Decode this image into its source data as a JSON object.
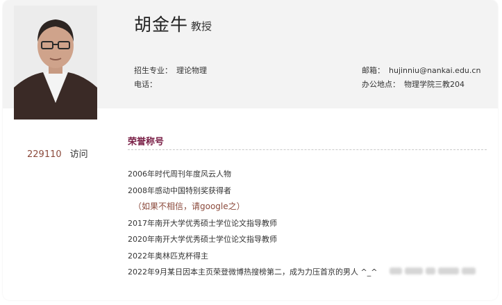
{
  "profile": {
    "name": "胡金牛",
    "title": "教授",
    "major_label": "招生专业：",
    "major_value": "理论物理",
    "phone_label": "电话：",
    "phone_value": "",
    "email_label": "邮箱：",
    "email_value": "hujinniu@nankai.edu.cn",
    "office_label": "办公地点：",
    "office_value": "物理学院三教204"
  },
  "visits": {
    "count": "229110",
    "label": "访问"
  },
  "honors": {
    "section_title": "荣誉称号",
    "items": [
      "2006年时代周刊年度风云人物",
      "2008年感动中国特别奖获得者",
      "（如果不相信，请google之）",
      "2017年南开大学优秀硕士学位论文指导教师",
      "2020年南开大学优秀硕士学位论文指导教师",
      "2022年奥林匹克杯得主",
      "2022年9月某日因本主页荣登微博热搜榜第二，成为力压首京的男人 ^_^"
    ]
  },
  "colors": {
    "header_band": "#f3f3f3",
    "accent_text": "#8b4a3c",
    "section_title": "#7a2047"
  }
}
